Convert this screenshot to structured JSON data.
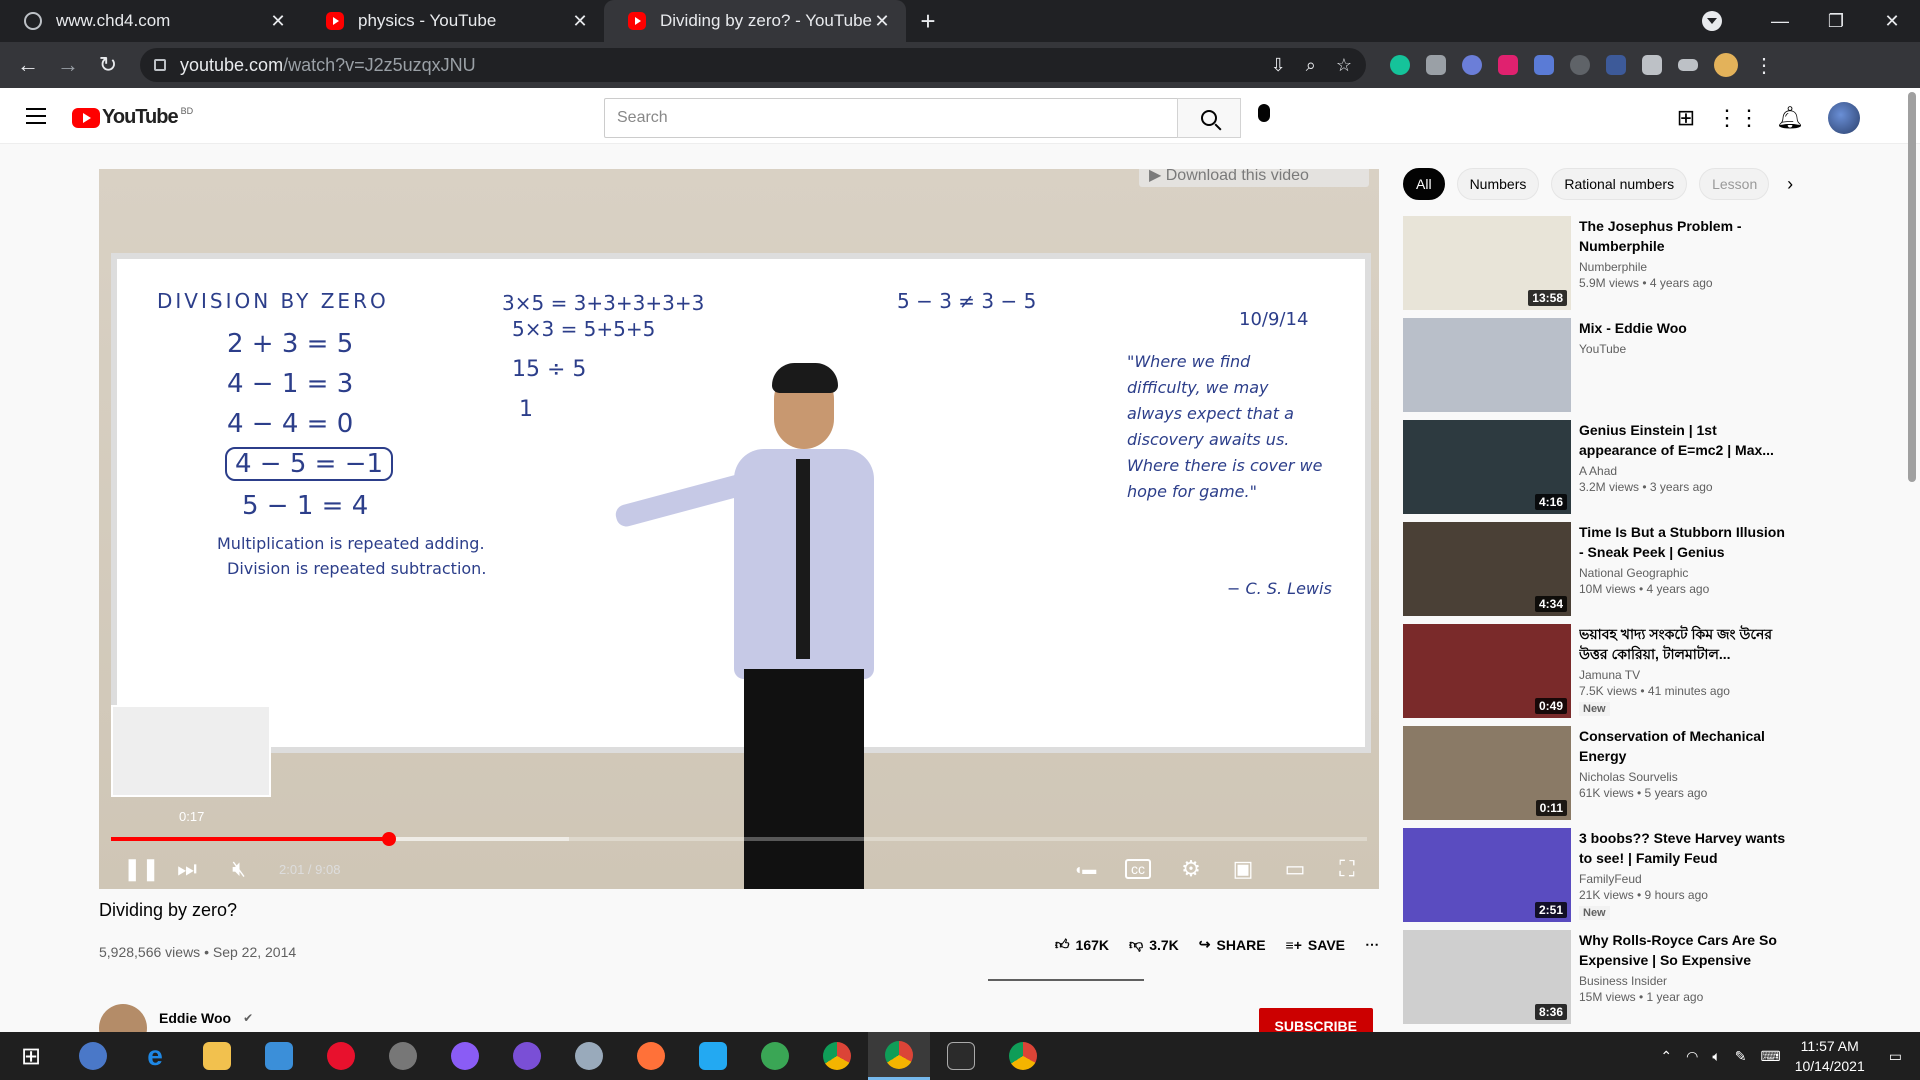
{
  "browser": {
    "tabs": [
      {
        "title": "www.chd4.com",
        "icon": "globe-icon"
      },
      {
        "title": "physics - YouTube",
        "icon": "youtube-icon"
      },
      {
        "title": "Dividing by zero? - YouTube",
        "icon": "youtube-icon"
      }
    ],
    "url_main": "youtube.com",
    "url_path": "/watch?v=J2z5uzqxJNU"
  },
  "youtube": {
    "logo_text": "YouTube",
    "country_code": "BD",
    "search_placeholder": "Search"
  },
  "player": {
    "download_text": "▶ Download this video",
    "hover_time": "0:17",
    "time_display": "2:01 / 9:08",
    "progress_played": 0.2215,
    "progress_buffered": 0.365,
    "board": {
      "heading": "DIVISION BY ZERO",
      "lines": [
        "2 + 3 = 5",
        "4 − 1 = 3",
        "4 − 4 = 0",
        "4 − 5 = −1",
        "5 − 1 = 4"
      ],
      "mult": "Multiplication is repeated adding.",
      "div": "Division is repeated subtraction.",
      "eq1": "3×5 = 3+3+3+3+3",
      "eq2": "5×3 = 5+5+5",
      "eq3": "15 ÷ 5",
      "eq4": "1",
      "ineq": "5 − 3 ≠ 3 − 5",
      "date": "10/9/14",
      "quote": "\"Where we find difficulty, we may always expect that a discovery awaits us. Where there is cover we hope for game.\"",
      "author": "− C. S. Lewis"
    }
  },
  "video": {
    "title": "Dividing by zero?",
    "meta": "5,928,566 views • Sep 22, 2014",
    "likes": "167K",
    "dislikes": "3.7K",
    "share": "SHARE",
    "save": "SAVE",
    "channel": "Eddie Woo",
    "subscribe": "SUBSCRIBE"
  },
  "chips": [
    "All",
    "Numbers",
    "Rational numbers",
    "Lesson"
  ],
  "recommendations": [
    {
      "title": "The Josephus Problem - Numberphile",
      "channel": "Numberphile",
      "views": "5.9M views • 4 years ago",
      "duration": "13:58",
      "color": "#e8e4d8",
      "new": ""
    },
    {
      "title": "Mix - Eddie Woo",
      "channel": "YouTube",
      "views": "",
      "duration": "",
      "color": "#b9bfc9",
      "new": ""
    },
    {
      "title": "Genius Einstein | 1st appearance of E=mc2 | Max...",
      "channel": "A Ahad",
      "views": "3.2M views • 3 years ago",
      "duration": "4:16",
      "color": "#2d3a40",
      "new": ""
    },
    {
      "title": "Time Is But a Stubborn Illusion - Sneak Peek | Genius",
      "channel": "National Geographic",
      "views": "10M views • 4 years ago",
      "duration": "4:34",
      "color": "#4a4036",
      "new": ""
    },
    {
      "title": "ভয়াবহ খাদ্য সংকটে কিম জং উনের উত্তর কোরিয়া, টালমাটাল...",
      "channel": "Jamuna TV",
      "views": "7.5K views • 41 minutes ago",
      "duration": "0:49",
      "color": "#7a2a2a",
      "new": "New"
    },
    {
      "title": "Conservation of Mechanical Energy",
      "channel": "Nicholas Sourvelis",
      "views": "61K views • 5 years ago",
      "duration": "0:11",
      "color": "#8a7a66",
      "new": ""
    },
    {
      "title": "3 boobs?? Steve Harvey wants to see! | Family Feud",
      "channel": "FamilyFeud",
      "views": "21K views • 9 hours ago",
      "duration": "2:51",
      "color": "#5a4cc0",
      "new": "New"
    },
    {
      "title": "Why Rolls-Royce Cars Are So Expensive | So Expensive",
      "channel": "Business Insider",
      "views": "15M views • 1 year ago",
      "duration": "8:36",
      "color": "#cfcfcf",
      "new": ""
    }
  ],
  "taskbar": {
    "time": "11:57 AM",
    "date": "10/14/2021"
  },
  "colors": {
    "accent": "#ff0000",
    "subscribe": "#cc0000"
  }
}
